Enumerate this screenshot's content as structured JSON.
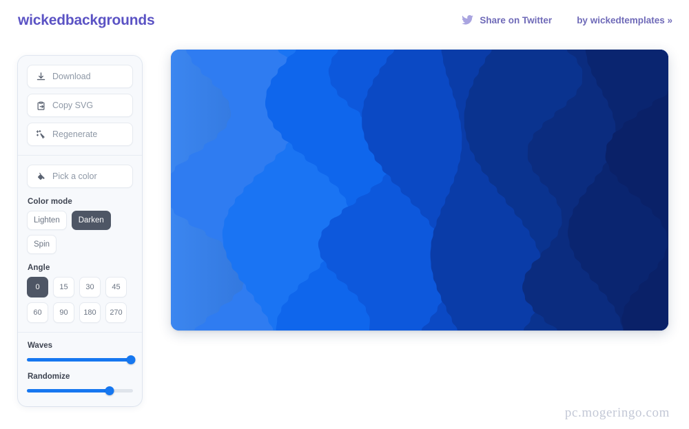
{
  "header": {
    "brand": "wickedbackgrounds",
    "brand_color": "#5b53c4",
    "links": [
      {
        "label": "Share on Twitter",
        "icon": "twitter-icon"
      },
      {
        "label": "by wickedtemplates »",
        "icon": "none"
      }
    ]
  },
  "sidebar": {
    "actions": [
      {
        "label": "Download",
        "icon": "download-icon"
      },
      {
        "label": "Copy SVG",
        "icon": "clipboard-export-icon"
      },
      {
        "label": "Regenerate",
        "icon": "magic-wand-icon"
      }
    ],
    "color_picker": {
      "label": "Pick a color",
      "icon": "paint-bucket-icon"
    },
    "color_mode": {
      "label": "Color mode",
      "options": [
        "Lighten",
        "Darken",
        "Spin"
      ],
      "selected": "Darken"
    },
    "angle": {
      "label": "Angle",
      "row1": [
        "0",
        "15",
        "30",
        "45"
      ],
      "row2": [
        "60",
        "90",
        "180",
        "270"
      ],
      "selected": "0"
    },
    "sliders": [
      {
        "label": "Waves",
        "value": 100
      },
      {
        "label": "Randomize",
        "value": 78
      }
    ],
    "accent_color": "#1677f0",
    "active_chip_color": "#4e5665"
  },
  "canvas": {
    "type": "wave-gradient-background",
    "gradient_from": "#3b86f0",
    "gradient_to": "#0a2a7a",
    "bands": [
      "#4a8bf2",
      "#2f7cf1",
      "#1a74f3",
      "#0f66ec",
      "#0d58dc",
      "#0b49c4",
      "#0a3ca8",
      "#0a338f",
      "#0b2c7f",
      "#0a2570",
      "#0a2168"
    ]
  },
  "watermark": "pc.mogeringo.com"
}
